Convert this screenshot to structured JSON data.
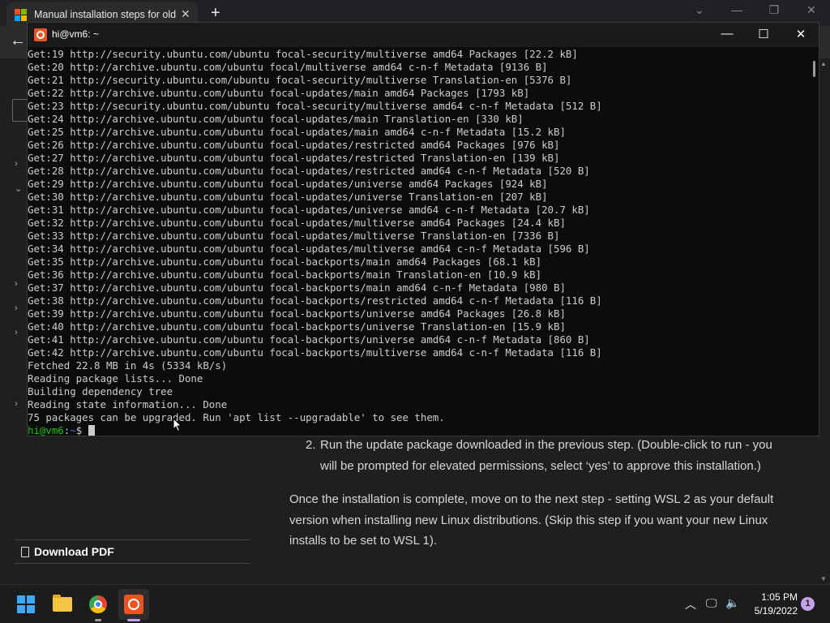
{
  "browser": {
    "tab_title": "Manual installation steps for older versions of WSL",
    "new_tab_symbol": "+",
    "back_symbol": "←"
  },
  "sidebar": {
    "download_pdf_label": "Download PDF"
  },
  "article": {
    "step_number": "2.",
    "step_text": "Run the update package downloaded in the previous step. (Double-click to run - you will be prompted for elevated permissions, select ‘yes’ to approve this installation.)",
    "paragraph": "Once the installation is complete, move on to the next step - setting WSL 2 as your default version when installing new Linux distributions. (Skip this step if you want your new Linux installs to be set to WSL 1)."
  },
  "terminal": {
    "title": "hi@vm6: ~",
    "lines": [
      "Get:19 http://security.ubuntu.com/ubuntu focal-security/multiverse amd64 Packages [22.2 kB]",
      "Get:20 http://archive.ubuntu.com/ubuntu focal/multiverse amd64 c-n-f Metadata [9136 B]",
      "Get:21 http://security.ubuntu.com/ubuntu focal-security/multiverse Translation-en [5376 B]",
      "Get:22 http://archive.ubuntu.com/ubuntu focal-updates/main amd64 Packages [1793 kB]",
      "Get:23 http://security.ubuntu.com/ubuntu focal-security/multiverse amd64 c-n-f Metadata [512 B]",
      "Get:24 http://archive.ubuntu.com/ubuntu focal-updates/main Translation-en [330 kB]",
      "Get:25 http://archive.ubuntu.com/ubuntu focal-updates/main amd64 c-n-f Metadata [15.2 kB]",
      "Get:26 http://archive.ubuntu.com/ubuntu focal-updates/restricted amd64 Packages [976 kB]",
      "Get:27 http://archive.ubuntu.com/ubuntu focal-updates/restricted Translation-en [139 kB]",
      "Get:28 http://archive.ubuntu.com/ubuntu focal-updates/restricted amd64 c-n-f Metadata [520 B]",
      "Get:29 http://archive.ubuntu.com/ubuntu focal-updates/universe amd64 Packages [924 kB]",
      "Get:30 http://archive.ubuntu.com/ubuntu focal-updates/universe Translation-en [207 kB]",
      "Get:31 http://archive.ubuntu.com/ubuntu focal-updates/universe amd64 c-n-f Metadata [20.7 kB]",
      "Get:32 http://archive.ubuntu.com/ubuntu focal-updates/multiverse amd64 Packages [24.4 kB]",
      "Get:33 http://archive.ubuntu.com/ubuntu focal-updates/multiverse Translation-en [7336 B]",
      "Get:34 http://archive.ubuntu.com/ubuntu focal-updates/multiverse amd64 c-n-f Metadata [596 B]",
      "Get:35 http://archive.ubuntu.com/ubuntu focal-backports/main amd64 Packages [68.1 kB]",
      "Get:36 http://archive.ubuntu.com/ubuntu focal-backports/main Translation-en [10.9 kB]",
      "Get:37 http://archive.ubuntu.com/ubuntu focal-backports/main amd64 c-n-f Metadata [980 B]",
      "Get:38 http://archive.ubuntu.com/ubuntu focal-backports/restricted amd64 c-n-f Metadata [116 B]",
      "Get:39 http://archive.ubuntu.com/ubuntu focal-backports/universe amd64 Packages [26.8 kB]",
      "Get:40 http://archive.ubuntu.com/ubuntu focal-backports/universe Translation-en [15.9 kB]",
      "Get:41 http://archive.ubuntu.com/ubuntu focal-backports/universe amd64 c-n-f Metadata [860 B]",
      "Get:42 http://archive.ubuntu.com/ubuntu focal-backports/multiverse amd64 c-n-f Metadata [116 B]",
      "Fetched 22.8 MB in 4s (5334 kB/s)",
      "Reading package lists... Done",
      "Building dependency tree",
      "Reading state information... Done",
      "75 packages can be upgraded. Run 'apt list --upgradable' to see them."
    ],
    "prompt_user": "hi@vm6",
    "prompt_sep": ":",
    "prompt_path": "~",
    "prompt_symbol": "$ "
  },
  "taskbar": {
    "time": "1:05 PM",
    "date": "5/19/2022",
    "notification_count": "1"
  },
  "colors": {
    "ubuntu_orange": "#e95420",
    "prompt_green": "#16c60c",
    "prompt_blue": "#3b78ff"
  },
  "icons": [
    "windows-logo-icon",
    "close-icon",
    "plus-icon",
    "back-arrow-icon",
    "chevron-right-icon",
    "chevron-down-icon",
    "document-icon",
    "ubuntu-icon",
    "minimize-icon",
    "maximize-icon",
    "start-icon",
    "file-explorer-icon",
    "chrome-icon",
    "chevron-up-icon",
    "network-icon",
    "volume-icon",
    "mouse-pointer-icon"
  ]
}
